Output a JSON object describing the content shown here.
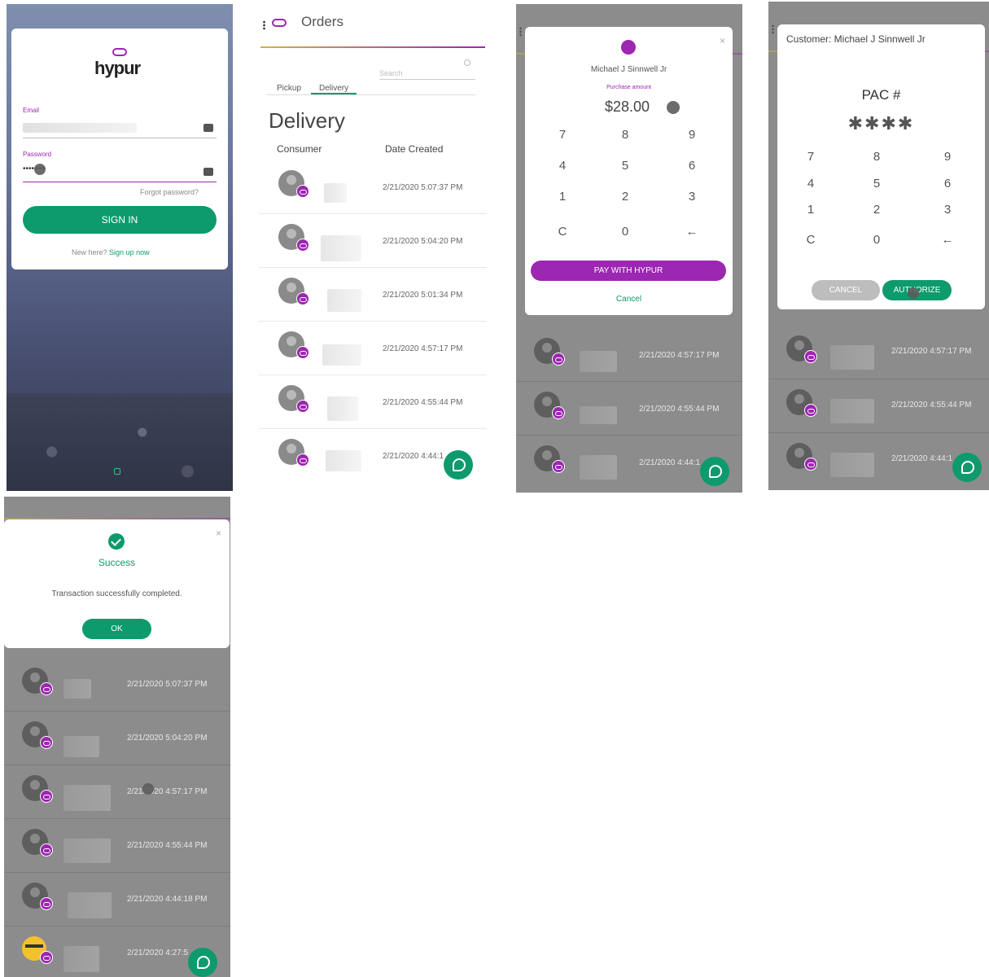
{
  "login": {
    "brand": "hypur",
    "email_label": "Email",
    "password_label": "Password",
    "password_value": "••••••••",
    "forgot": "Forgot password?",
    "sign_in": "SIGN IN",
    "new_here": "New here?",
    "sign_up": "Sign up now"
  },
  "orders": {
    "title": "Orders",
    "search_placeholder": "Search",
    "tabs": [
      "Pickup",
      "Delivery"
    ],
    "section_title": "Delivery",
    "col_consumer": "Consumer",
    "col_date": "Date Created",
    "rows": [
      {
        "date": "2/21/2020 5:07:37 PM"
      },
      {
        "date": "2/21/2020 5:04:20 PM"
      },
      {
        "date": "2/21/2020 5:01:34 PM"
      },
      {
        "date": "2/21/2020 4:57:17 PM"
      },
      {
        "date": "2/21/2020 4:55:44 PM"
      },
      {
        "date": "2/21/2020 4:44:1"
      }
    ]
  },
  "pay_modal": {
    "customer": "Michael J Sinnwell Jr",
    "purchase_label": "Purchase amount",
    "currency": "$",
    "amount": "28.00",
    "keys": [
      "7",
      "8",
      "9",
      "4",
      "5",
      "6",
      "1",
      "2",
      "3",
      "C",
      "0",
      "←"
    ],
    "pay_button": "PAY WITH HYPUR",
    "cancel": "Cancel",
    "bg_rows": [
      {
        "date": "2/21/2020 4:57:17 PM"
      },
      {
        "date": "2/21/2020 4:55:44 PM"
      },
      {
        "date": "2/21/2020 4:44:1"
      }
    ]
  },
  "pac_modal": {
    "customer": "Customer: Michael J Sinnwell Jr",
    "pac_label": "PAC #",
    "pac_value": "✱✱✱✱",
    "keys": [
      "7",
      "8",
      "9",
      "4",
      "5",
      "6",
      "1",
      "2",
      "3",
      "C",
      "0",
      "←"
    ],
    "cancel": "CANCEL",
    "authorize": "AUTHORIZE",
    "bg_rows": [
      {
        "date": "2/21/2020 4:57:17 PM"
      },
      {
        "date": "2/21/2020 4:55:44 PM"
      },
      {
        "date": "2/21/2020 4:44:1"
      }
    ]
  },
  "success": {
    "title": "Success",
    "message": "Transaction successfully completed.",
    "ok": "OK",
    "rows": [
      {
        "date": "2/21/2020 5:07:37 PM"
      },
      {
        "date": "2/21/2020 5:04:20 PM"
      },
      {
        "date": "2/21/2020 4:57:17 PM"
      },
      {
        "date": "2/21/2020 4:55:44 PM"
      },
      {
        "date": "2/21/2020 4:44:18 PM"
      },
      {
        "date": "2/21/2020 4:27:5"
      }
    ]
  },
  "colors": {
    "brand_green": "#0d9a6d",
    "brand_purple": "#9c27b0"
  }
}
